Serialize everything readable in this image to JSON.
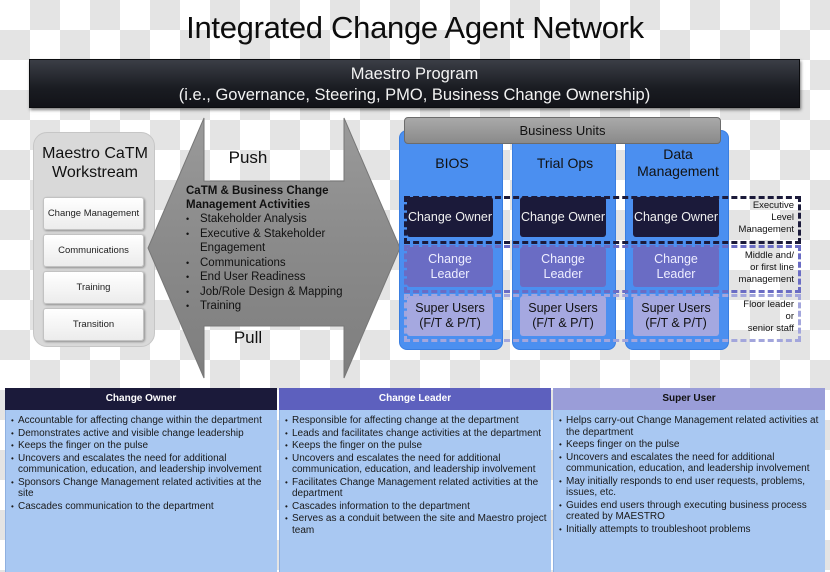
{
  "title": "Integrated Change Agent Network",
  "program": {
    "line1": "Maestro Program",
    "line2": "(i.e., Governance, Steering, PMO, Business Change Ownership)"
  },
  "workstream": {
    "title_line1": "Maestro CaTM",
    "title_line2": "Workstream",
    "items": [
      {
        "label": "Change Management"
      },
      {
        "label": "Communications"
      },
      {
        "label": "Training"
      },
      {
        "label": "Transition"
      }
    ]
  },
  "arrow": {
    "push_label": "Push",
    "pull_label": "Pull",
    "activities_title": "CaTM & Business Change Management Activities",
    "activities": [
      "Stakeholder Analysis",
      "Executive & Stakeholder Engagement",
      "Communications",
      "End User Readiness",
      "Job/Role Design & Mapping",
      "Training"
    ],
    "color": "#8c8c8c"
  },
  "business_units": {
    "header": "Business Units",
    "units": [
      {
        "name": "BIOS",
        "owner": "Change Owner",
        "leader": "Change Leader",
        "super": "Super Users (F/T & P/T)"
      },
      {
        "name": "Trial Ops",
        "owner": "Change Owner",
        "leader": "Change Leader",
        "super": "Super Users (F/T & P/T)"
      },
      {
        "name": "Data Management",
        "owner": "Change Owner",
        "leader": "Change Leader",
        "super": "Super Users (F/T & P/T)"
      }
    ],
    "levels": [
      {
        "label_line1": "Executive",
        "label_line2": "Level",
        "label_line3": "Management"
      },
      {
        "label_line1": "Middle and/",
        "label_line2": "or first line",
        "label_line3": "management"
      },
      {
        "label_line1": "Floor leader",
        "label_line2": "or",
        "label_line3": "senior staff"
      }
    ],
    "colors": {
      "unit_bg": "#4b8ff0",
      "owner": "#1b1a3a",
      "leader": "#6a6cc4",
      "super": "#a5a8e0"
    }
  },
  "descriptions": [
    {
      "role": "Change Owner",
      "items": [
        "Accountable for affecting change within the department",
        "Demonstrates active and visible change leadership",
        "Keeps the finger on the pulse",
        "Uncovers and escalates the need for additional communication, education, and leadership involvement",
        "Sponsors Change Management related activities at the site",
        "Cascades communication to the department"
      ]
    },
    {
      "role": "Change Leader",
      "items": [
        "Responsible for affecting change at the department",
        "Leads and facilitates change activities at the department",
        "Keeps the finger on the pulse",
        "Uncovers and escalates the need for additional communication, education, and leadership involvement",
        "Facilitates Change Management related activities at the department",
        "Cascades information to the department",
        "Serves as a conduit between the site and Maestro project team"
      ]
    },
    {
      "role": "Super User",
      "items": [
        "Helps carry-out Change Management related activities at the department",
        "Keeps finger on the pulse",
        "Uncovers and escalates the need for additional communication, education, and leadership involvement",
        "May initially responds to end user requests, problems, issues, etc.",
        "Guides end users through executing business process created by MAESTRO",
        "Initially attempts to troubleshoot problems"
      ]
    }
  ]
}
